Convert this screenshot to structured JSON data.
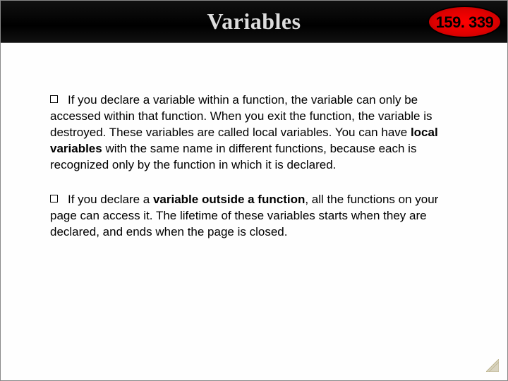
{
  "header": {
    "title": "Variables",
    "badge": "159. 339"
  },
  "bullets": [
    {
      "pre": "If you declare a variable within a function, the variable can only be accessed within that function. When you exit the function, the variable is destroyed. These variables are called local variables. You can have ",
      "bold": "local variables",
      "post": " with the same name in different functions, because each is recognized only by the function in which it is declared."
    },
    {
      "pre": "If you declare a ",
      "bold": "variable outside a function",
      "post": ", all the functions on your page can access it. The lifetime of these variables starts when they are declared, and ends when the page is closed."
    }
  ]
}
